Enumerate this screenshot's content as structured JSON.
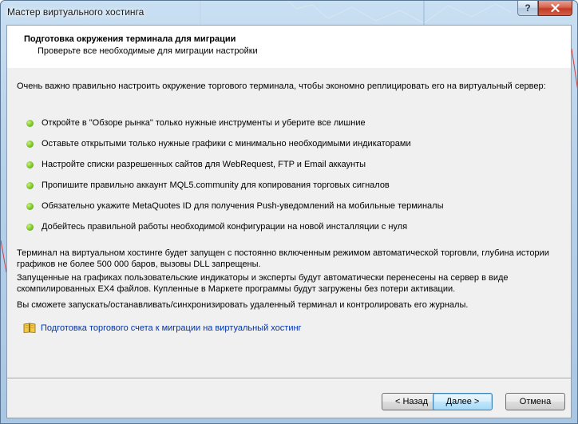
{
  "window": {
    "title": "Мастер виртуального хостинга",
    "help_label": "?",
    "close_label": "✕"
  },
  "header": {
    "title": "Подготовка окружения терминала для миграции",
    "subtitle": "Проверьте все необходимые для миграции настройки"
  },
  "body": {
    "intro": "Очень важно правильно настроить окружение торгового терминала, чтобы экономно реплицировать его на виртуальный сервер:",
    "checklist": [
      "Откройте в \"Обзоре рынка\" только нужные инструменты и уберите все лишние",
      "Оставьте открытыми только нужные графики с минимально необходимыми индикаторами",
      "Настройте списки разрешенных сайтов для WebRequest, FTP и Email аккаунты",
      "Пропишите правильно аккаунт MQL5.community для копирования торговых сигналов",
      "Обязательно укажите MetaQuotes ID для получения Push-уведомлений на мобильные терминалы",
      "Добейтесь правильной работы необходимой конфигурации на новой инсталляции с нуля"
    ],
    "paragraph1": "Терминал на виртуальном хостинге будет запущен с постоянно включенным режимом автоматической торговли, глубина истории графиков не более 500 000 баров, вызовы DLL запрещены.",
    "paragraph2": "Запущенные на графиках пользовательские индикаторы и эксперты будут автоматически перенесены на сервер в виде скомпилированных EX4 файлов. Купленные в Маркете программы будут загружены без потери активации.",
    "paragraph3": "Вы сможете запускать/останавливать/синхронизировать удаленный терминал и контролировать его журналы.",
    "help_link": "Подготовка торгового счета к миграции на виртуальный хостинг"
  },
  "buttons": {
    "back": "< Назад",
    "next": "Далее >",
    "cancel": "Отмена"
  },
  "colors": {
    "bullet": "#7cc52a",
    "link": "#0033aa",
    "close_button": "#c13b22"
  }
}
